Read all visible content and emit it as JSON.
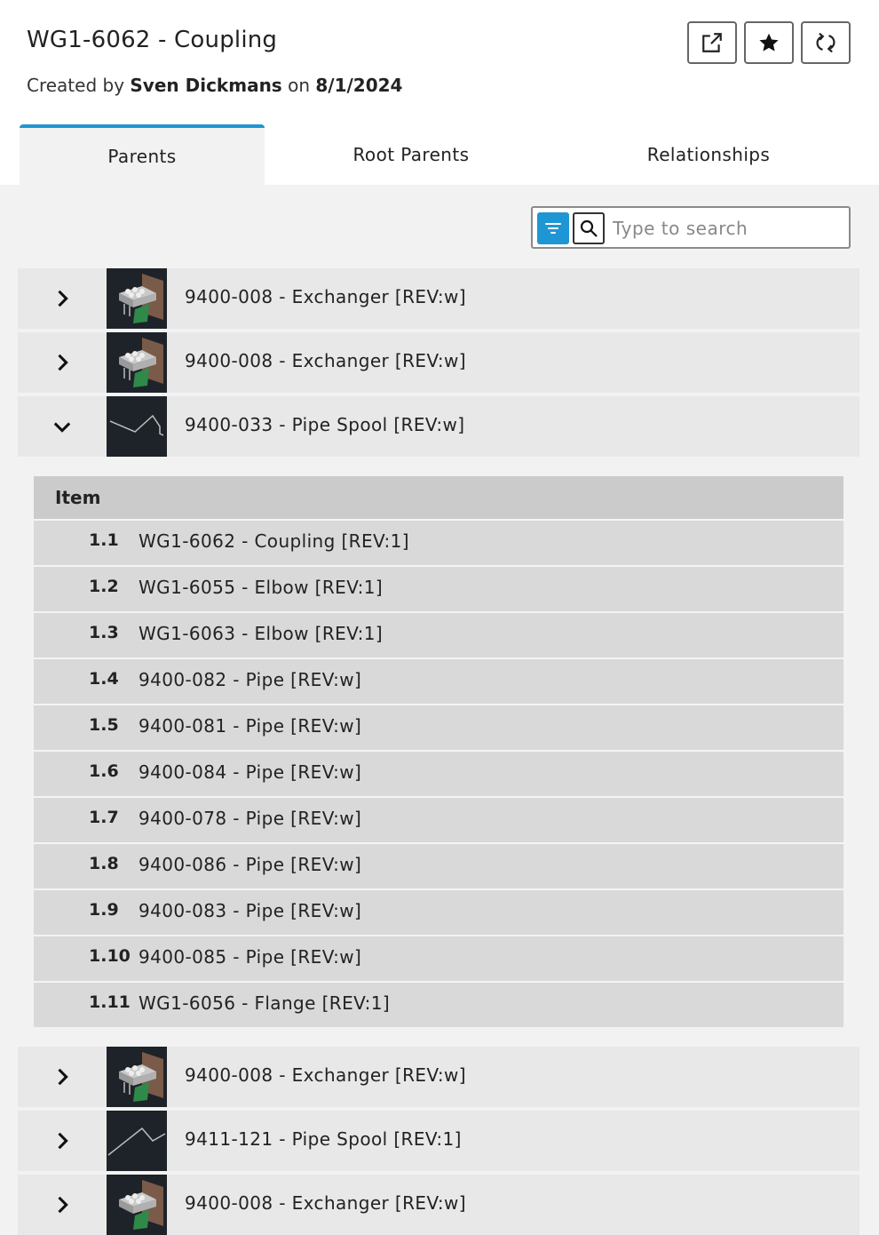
{
  "header": {
    "title": "WG1-6062 - Coupling",
    "created_prefix": "Created by",
    "author": "Sven Dickmans",
    "on": "on",
    "date": "8/1/2024",
    "buttons": [
      "open-external-icon",
      "star-icon",
      "refresh-icon"
    ]
  },
  "tabs": [
    {
      "label": "Parents",
      "active": true
    },
    {
      "label": "Root Parents",
      "active": false
    },
    {
      "label": "Relationships",
      "active": false
    }
  ],
  "search": {
    "placeholder": "Type to search",
    "value": ""
  },
  "parents": [
    {
      "label": "9400-008 - Exchanger [REV:w]",
      "thumb": "exchanger",
      "expanded": false
    },
    {
      "label": "9400-008 - Exchanger [REV:w]",
      "thumb": "exchanger",
      "expanded": false
    },
    {
      "label": "9400-033 - Pipe Spool [REV:w]",
      "thumb": "pipe-spool",
      "expanded": true
    },
    {
      "label": "9400-008 - Exchanger [REV:w]",
      "thumb": "exchanger",
      "expanded": false
    },
    {
      "label": "9411-121 - Pipe Spool [REV:1]",
      "thumb": "pipe-spool",
      "expanded": false
    },
    {
      "label": "9400-008 - Exchanger [REV:w]",
      "thumb": "exchanger",
      "expanded": false
    }
  ],
  "subtable": {
    "header": "Item",
    "rows": [
      {
        "num": "1.1",
        "label": "WG1-6062 - Coupling [REV:1]"
      },
      {
        "num": "1.2",
        "label": "WG1-6055 - Elbow [REV:1]"
      },
      {
        "num": "1.3",
        "label": "WG1-6063 - Elbow [REV:1]"
      },
      {
        "num": "1.4",
        "label": "9400-082 - Pipe [REV:w]"
      },
      {
        "num": "1.5",
        "label": "9400-081 - Pipe [REV:w]"
      },
      {
        "num": "1.6",
        "label": "9400-084 - Pipe [REV:w]"
      },
      {
        "num": "1.7",
        "label": "9400-078 - Pipe [REV:w]"
      },
      {
        "num": "1.8",
        "label": "9400-086 - Pipe [REV:w]"
      },
      {
        "num": "1.9",
        "label": "9400-083 - Pipe [REV:w]"
      },
      {
        "num": "1.10",
        "label": "9400-085 - Pipe [REV:w]"
      },
      {
        "num": "1.11",
        "label": "WG1-6056 - Flange [REV:1]"
      }
    ]
  },
  "colors": {
    "accent": "#1f96d4",
    "thumb_bg": "#1e2329"
  }
}
